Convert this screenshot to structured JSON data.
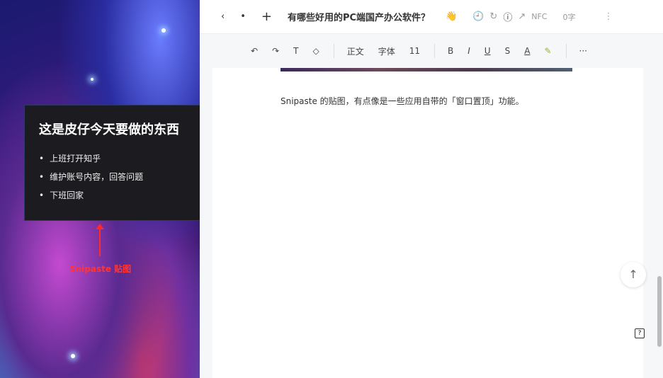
{
  "left": {
    "card_title": "这是皮仔今天要做的东西",
    "bullets": [
      "上班打开知乎",
      "维护账号内容，回答问题",
      "下班回家"
    ],
    "label": "Snipaste 贴图"
  },
  "topbar": {
    "back": "‹",
    "dot": "•",
    "add": "+",
    "title": "有哪些好用的PC端国产办公软件？",
    "emoji": "👋",
    "history": "🕘",
    "sync": "↻",
    "info": "ⓘ",
    "share": "↗",
    "status1": "NFC",
    "status2": "0字",
    "more": "⋮"
  },
  "toolbar": {
    "undo": "↶",
    "redo": "↷",
    "format": "T",
    "eraser": "◇",
    "paragraph": "正文",
    "font": "字体",
    "size": "11",
    "bold": "B",
    "italic": "I",
    "underline": "U",
    "strike": "S",
    "color": "A",
    "highlight": "✎",
    "more": "···"
  },
  "doc": {
    "paragraph": "Snipaste 的贴图，有点像是一些应用自带的「窗口置顶」功能。"
  },
  "float": {
    "top": "↑",
    "help": "?"
  }
}
